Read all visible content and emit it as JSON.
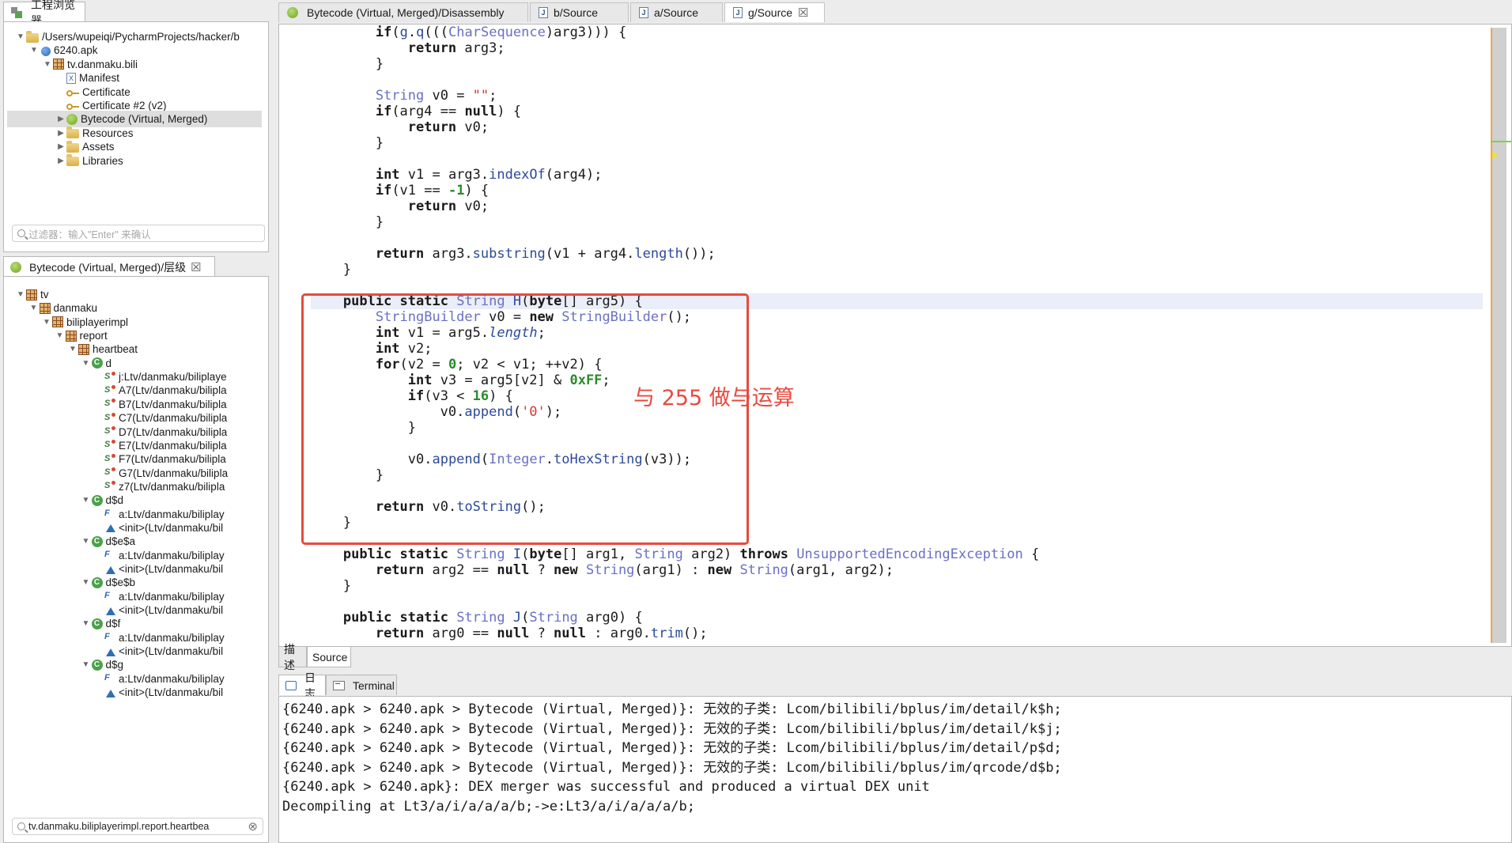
{
  "explorer": {
    "tab_label": "工程浏览器",
    "tree": [
      {
        "label": "/Users/wupeiqi/PycharmProjects/hacker/b",
        "icon": "folder-icon",
        "depth": 0,
        "toggle": "▼"
      },
      {
        "label": "6240.apk",
        "icon": "apk-icon",
        "depth": 1,
        "toggle": "▼"
      },
      {
        "label": "tv.danmaku.bili",
        "icon": "package-icon",
        "depth": 2,
        "toggle": "▼"
      },
      {
        "label": "Manifest",
        "icon": "manifest-icon",
        "depth": 3,
        "toggle": ""
      },
      {
        "label": "Certificate",
        "icon": "key-icon",
        "depth": 3,
        "toggle": ""
      },
      {
        "label": "Certificate #2 (v2)",
        "icon": "key-icon",
        "depth": 3,
        "toggle": ""
      },
      {
        "label": "Bytecode (Virtual, Merged)",
        "icon": "android-icon",
        "depth": 3,
        "toggle": "▶",
        "selected": true
      },
      {
        "label": "Resources",
        "icon": "folder-icon",
        "depth": 3,
        "toggle": "▶"
      },
      {
        "label": "Assets",
        "icon": "folder-icon",
        "depth": 3,
        "toggle": "▶"
      },
      {
        "label": "Libraries",
        "icon": "folder-icon",
        "depth": 3,
        "toggle": "▶"
      }
    ],
    "filter_placeholder": "过滤器：输入\"Enter\" 来确认"
  },
  "hierarchy": {
    "tab_label": "Bytecode (Virtual, Merged)/层级",
    "close": "☒",
    "tree": [
      {
        "label": "tv",
        "icon": "package-icon",
        "depth": 0,
        "toggle": "▼"
      },
      {
        "label": "danmaku",
        "icon": "package-icon",
        "depth": 1,
        "toggle": "▼"
      },
      {
        "label": "biliplayerimpl",
        "icon": "package-icon",
        "depth": 2,
        "toggle": "▼"
      },
      {
        "label": "report",
        "icon": "package-icon",
        "depth": 3,
        "toggle": "▼"
      },
      {
        "label": "heartbeat",
        "icon": "package-icon",
        "depth": 4,
        "toggle": "▼"
      },
      {
        "label": "d",
        "icon": "class-icon",
        "depth": 5,
        "toggle": "▼"
      },
      {
        "label": "j:Ltv/danmaku/biliplaye",
        "icon": "method-icon",
        "depth": 6,
        "toggle": ""
      },
      {
        "label": "A7(Ltv/danmaku/bilipla",
        "icon": "method-icon",
        "depth": 6,
        "toggle": ""
      },
      {
        "label": "B7(Ltv/danmaku/bilipla",
        "icon": "method-icon",
        "depth": 6,
        "toggle": ""
      },
      {
        "label": "C7(Ltv/danmaku/bilipla",
        "icon": "method-icon",
        "depth": 6,
        "toggle": ""
      },
      {
        "label": "D7(Ltv/danmaku/bilipla",
        "icon": "method-icon",
        "depth": 6,
        "toggle": ""
      },
      {
        "label": "E7(Ltv/danmaku/bilipla",
        "icon": "method-icon",
        "depth": 6,
        "toggle": ""
      },
      {
        "label": "F7(Ltv/danmaku/bilipla",
        "icon": "method-icon",
        "depth": 6,
        "toggle": ""
      },
      {
        "label": "G7(Ltv/danmaku/bilipla",
        "icon": "method-icon",
        "depth": 6,
        "toggle": ""
      },
      {
        "label": "z7(Ltv/danmaku/bilipla",
        "icon": "method-icon",
        "depth": 6,
        "toggle": ""
      },
      {
        "label": "d$d",
        "icon": "class-icon",
        "depth": 5,
        "toggle": "▼"
      },
      {
        "label": "a:Ltv/danmaku/biliplay",
        "icon": "field-icon",
        "depth": 6,
        "toggle": ""
      },
      {
        "label": "<init>(Ltv/danmaku/bil",
        "icon": "constructor-icon",
        "depth": 6,
        "toggle": ""
      },
      {
        "label": "d$e$a",
        "icon": "class-icon",
        "depth": 5,
        "toggle": "▼"
      },
      {
        "label": "a:Ltv/danmaku/biliplay",
        "icon": "field-icon",
        "depth": 6,
        "toggle": ""
      },
      {
        "label": "<init>(Ltv/danmaku/bil",
        "icon": "constructor-icon",
        "depth": 6,
        "toggle": ""
      },
      {
        "label": "d$e$b",
        "icon": "class-icon",
        "depth": 5,
        "toggle": "▼"
      },
      {
        "label": "a:Ltv/danmaku/biliplay",
        "icon": "field-icon",
        "depth": 6,
        "toggle": ""
      },
      {
        "label": "<init>(Ltv/danmaku/bil",
        "icon": "constructor-icon",
        "depth": 6,
        "toggle": ""
      },
      {
        "label": "d$f",
        "icon": "class-icon",
        "depth": 5,
        "toggle": "▼"
      },
      {
        "label": "a:Ltv/danmaku/biliplay",
        "icon": "field-icon",
        "depth": 6,
        "toggle": ""
      },
      {
        "label": "<init>(Ltv/danmaku/bil",
        "icon": "constructor-icon",
        "depth": 6,
        "toggle": ""
      },
      {
        "label": "d$g",
        "icon": "class-icon",
        "depth": 5,
        "toggle": "▼"
      },
      {
        "label": "a:Ltv/danmaku/biliplay",
        "icon": "field-icon",
        "depth": 6,
        "toggle": ""
      },
      {
        "label": "<init>(Ltv/danmaku/bil",
        "icon": "constructor-icon",
        "depth": 6,
        "toggle": ""
      }
    ],
    "search_value": "tv.danmaku.biliplayerimpl.report.heartbea",
    "clear": "⊗"
  },
  "editor_tabs": [
    {
      "label": "Bytecode (Virtual, Merged)/Disassembly",
      "icon": "android-icon"
    },
    {
      "label": "b/Source",
      "icon": "java-file-icon"
    },
    {
      "label": "a/Source",
      "icon": "java-file-icon"
    },
    {
      "label": "g/Source",
      "icon": "java-file-icon",
      "active": true,
      "close": "☒"
    }
  ],
  "code_lines": [
    {
      "indent": 8,
      "t": [
        [
          "kw",
          "if"
        ],
        [
          "p",
          "("
        ],
        [
          "fn",
          "g"
        ],
        [
          "p",
          "."
        ],
        [
          "fn",
          "q"
        ],
        [
          "p",
          "((("
        ],
        [
          "ty",
          "CharSequence"
        ],
        [
          "p",
          ")arg3))) {"
        ]
      ]
    },
    {
      "indent": 12,
      "t": [
        [
          "kw",
          "return"
        ],
        [
          "p",
          " arg3;"
        ]
      ]
    },
    {
      "indent": 8,
      "t": [
        [
          "p",
          "}"
        ]
      ]
    },
    {
      "indent": 0,
      "t": []
    },
    {
      "indent": 8,
      "t": [
        [
          "ty",
          "String"
        ],
        [
          "p",
          " v0 = "
        ],
        [
          "str",
          "\"\""
        ],
        [
          "p",
          ";"
        ]
      ]
    },
    {
      "indent": 8,
      "t": [
        [
          "kw",
          "if"
        ],
        [
          "p",
          "(arg4 == "
        ],
        [
          "kw",
          "null"
        ],
        [
          "p",
          ") {"
        ]
      ]
    },
    {
      "indent": 12,
      "t": [
        [
          "kw",
          "return"
        ],
        [
          "p",
          " v0;"
        ]
      ]
    },
    {
      "indent": 8,
      "t": [
        [
          "p",
          "}"
        ]
      ]
    },
    {
      "indent": 0,
      "t": []
    },
    {
      "indent": 8,
      "t": [
        [
          "kw",
          "int"
        ],
        [
          "p",
          " v1 = arg3."
        ],
        [
          "fn",
          "indexOf"
        ],
        [
          "p",
          "(arg4);"
        ]
      ]
    },
    {
      "indent": 8,
      "t": [
        [
          "kw",
          "if"
        ],
        [
          "p",
          "(v1 == "
        ],
        [
          "num",
          "-1"
        ],
        [
          "p",
          ") {"
        ]
      ]
    },
    {
      "indent": 12,
      "t": [
        [
          "kw",
          "return"
        ],
        [
          "p",
          " v0;"
        ]
      ]
    },
    {
      "indent": 8,
      "t": [
        [
          "p",
          "}"
        ]
      ]
    },
    {
      "indent": 0,
      "t": []
    },
    {
      "indent": 8,
      "t": [
        [
          "kw",
          "return"
        ],
        [
          "p",
          " arg3."
        ],
        [
          "fn",
          "substring"
        ],
        [
          "p",
          "(v1 + arg4."
        ],
        [
          "fn",
          "length"
        ],
        [
          "p",
          "());"
        ]
      ]
    },
    {
      "indent": 4,
      "t": [
        [
          "p",
          "}"
        ]
      ]
    },
    {
      "indent": 0,
      "t": []
    },
    {
      "indent": 4,
      "hl": true,
      "t": [
        [
          "kw",
          "public static "
        ],
        [
          "ty",
          "String"
        ],
        [
          "p",
          " "
        ],
        [
          "fn",
          "H"
        ],
        [
          "p",
          "("
        ],
        [
          "kw",
          "byte"
        ],
        [
          "p",
          "[] arg5) {"
        ]
      ]
    },
    {
      "indent": 8,
      "t": [
        [
          "ty",
          "StringBuilder"
        ],
        [
          "p",
          " v0 = "
        ],
        [
          "kw",
          "new "
        ],
        [
          "ty",
          "StringBuilder"
        ],
        [
          "p",
          "();"
        ]
      ]
    },
    {
      "indent": 8,
      "t": [
        [
          "kw",
          "int"
        ],
        [
          "p",
          " v1 = arg5."
        ],
        [
          "fld",
          "length"
        ],
        [
          "p",
          ";"
        ]
      ]
    },
    {
      "indent": 8,
      "t": [
        [
          "kw",
          "int"
        ],
        [
          "p",
          " v2;"
        ]
      ]
    },
    {
      "indent": 8,
      "t": [
        [
          "kw",
          "for"
        ],
        [
          "p",
          "(v2 = "
        ],
        [
          "num",
          "0"
        ],
        [
          "p",
          "; v2 < v1; ++v2) {"
        ]
      ]
    },
    {
      "indent": 12,
      "t": [
        [
          "kw",
          "int"
        ],
        [
          "p",
          " v3 = arg5[v2] & "
        ],
        [
          "num",
          "0xFF"
        ],
        [
          "p",
          ";"
        ]
      ]
    },
    {
      "indent": 12,
      "t": [
        [
          "kw",
          "if"
        ],
        [
          "p",
          "(v3 < "
        ],
        [
          "num",
          "16"
        ],
        [
          "p",
          ") {"
        ]
      ]
    },
    {
      "indent": 16,
      "t": [
        [
          "p",
          "v0."
        ],
        [
          "fn",
          "append"
        ],
        [
          "p",
          "("
        ],
        [
          "str",
          "'0'"
        ],
        [
          "p",
          ");"
        ]
      ]
    },
    {
      "indent": 12,
      "t": [
        [
          "p",
          "}"
        ]
      ]
    },
    {
      "indent": 0,
      "t": []
    },
    {
      "indent": 12,
      "t": [
        [
          "p",
          "v0."
        ],
        [
          "fn",
          "append"
        ],
        [
          "p",
          "("
        ],
        [
          "ty",
          "Integer"
        ],
        [
          "p",
          "."
        ],
        [
          "fn",
          "toHexString"
        ],
        [
          "p",
          "(v3));"
        ]
      ]
    },
    {
      "indent": 8,
      "t": [
        [
          "p",
          "}"
        ]
      ]
    },
    {
      "indent": 0,
      "t": []
    },
    {
      "indent": 8,
      "t": [
        [
          "kw",
          "return"
        ],
        [
          "p",
          " v0."
        ],
        [
          "fn",
          "toString"
        ],
        [
          "p",
          "();"
        ]
      ]
    },
    {
      "indent": 4,
      "t": [
        [
          "p",
          "}"
        ]
      ]
    },
    {
      "indent": 0,
      "t": []
    },
    {
      "indent": 4,
      "t": [
        [
          "kw",
          "public static "
        ],
        [
          "ty",
          "String"
        ],
        [
          "p",
          " "
        ],
        [
          "fn",
          "I"
        ],
        [
          "p",
          "("
        ],
        [
          "kw",
          "byte"
        ],
        [
          "p",
          "[] arg1, "
        ],
        [
          "ty",
          "String"
        ],
        [
          "p",
          " arg2) "
        ],
        [
          "kw",
          "throws "
        ],
        [
          "ty",
          "UnsupportedEncodingException"
        ],
        [
          "p",
          " {"
        ]
      ]
    },
    {
      "indent": 8,
      "t": [
        [
          "kw",
          "return"
        ],
        [
          "p",
          " arg2 == "
        ],
        [
          "kw",
          "null"
        ],
        [
          "p",
          " ? "
        ],
        [
          "kw",
          "new "
        ],
        [
          "ty",
          "String"
        ],
        [
          "p",
          "(arg1) : "
        ],
        [
          "kw",
          "new "
        ],
        [
          "ty",
          "String"
        ],
        [
          "p",
          "(arg1, arg2);"
        ]
      ]
    },
    {
      "indent": 4,
      "t": [
        [
          "p",
          "}"
        ]
      ]
    },
    {
      "indent": 0,
      "t": []
    },
    {
      "indent": 4,
      "t": [
        [
          "kw",
          "public static "
        ],
        [
          "ty",
          "String"
        ],
        [
          "p",
          " "
        ],
        [
          "fn",
          "J"
        ],
        [
          "p",
          "("
        ],
        [
          "ty",
          "String"
        ],
        [
          "p",
          " arg0) {"
        ]
      ]
    },
    {
      "indent": 8,
      "t": [
        [
          "kw",
          "return"
        ],
        [
          "p",
          " arg0 == "
        ],
        [
          "kw",
          "null"
        ],
        [
          "p",
          " ? "
        ],
        [
          "kw",
          "null"
        ],
        [
          "p",
          " : arg0."
        ],
        [
          "fn",
          "trim"
        ],
        [
          "p",
          "();"
        ]
      ]
    }
  ],
  "annotation": "与 255 做与运算",
  "editor_bottom_tabs": [
    {
      "label": "描述"
    },
    {
      "label": "Source",
      "active": true
    }
  ],
  "console_tabs": [
    {
      "label": "日志",
      "icon": "log-icon",
      "active": true
    },
    {
      "label": "Terminal",
      "icon": "terminal-icon"
    }
  ],
  "console_lines": [
    "{6240.apk > 6240.apk > Bytecode (Virtual, Merged)}: 无效的子类: Lcom/bilibili/bplus/im/detail/k$h;",
    "{6240.apk > 6240.apk > Bytecode (Virtual, Merged)}: 无效的子类: Lcom/bilibili/bplus/im/detail/k$j;",
    "{6240.apk > 6240.apk > Bytecode (Virtual, Merged)}: 无效的子类: Lcom/bilibili/bplus/im/detail/p$d;",
    "{6240.apk > 6240.apk > Bytecode (Virtual, Merged)}: 无效的子类: Lcom/bilibili/bplus/im/qrcode/d$b;",
    "{6240.apk > 6240.apk}: DEX merger was successful and produced a virtual DEX unit",
    "Decompiling at Lt3/a/i/a/a/a/b;->e:Lt3/a/i/a/a/a/b;"
  ],
  "colors": {
    "annotation": "#e84a3f",
    "keyword": "#1a1a1a",
    "type": "#6a6fc4",
    "string": "#d23a2c",
    "number": "#2c8a2c"
  }
}
